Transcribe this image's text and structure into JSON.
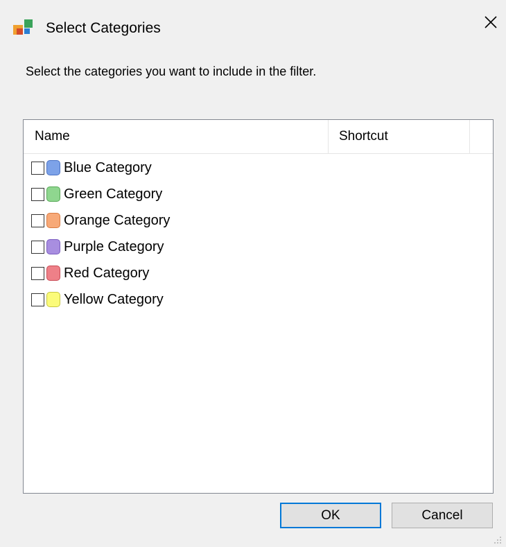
{
  "window": {
    "title": "Select Categories"
  },
  "instruction": "Select the categories you want to include in the filter.",
  "list": {
    "columns": [
      "Name",
      "Shortcut"
    ],
    "items": [
      {
        "label": "Blue Category",
        "color": "#7da2e8",
        "border": "#4a72c4",
        "checked": false
      },
      {
        "label": "Green Category",
        "color": "#8fd68f",
        "border": "#55a855",
        "checked": false
      },
      {
        "label": "Orange Category",
        "color": "#f7a978",
        "border": "#d87a40",
        "checked": false
      },
      {
        "label": "Purple Category",
        "color": "#a88ee0",
        "border": "#7a5bc0",
        "checked": false
      },
      {
        "label": "Red Category",
        "color": "#ee8088",
        "border": "#c94a55",
        "checked": false
      },
      {
        "label": "Yellow Category",
        "color": "#fbfb7a",
        "border": "#c8c840",
        "checked": false
      }
    ]
  },
  "buttons": {
    "ok": "OK",
    "cancel": "Cancel"
  },
  "colors": {
    "accent": "#0078d7",
    "background": "#f0f0f0"
  }
}
